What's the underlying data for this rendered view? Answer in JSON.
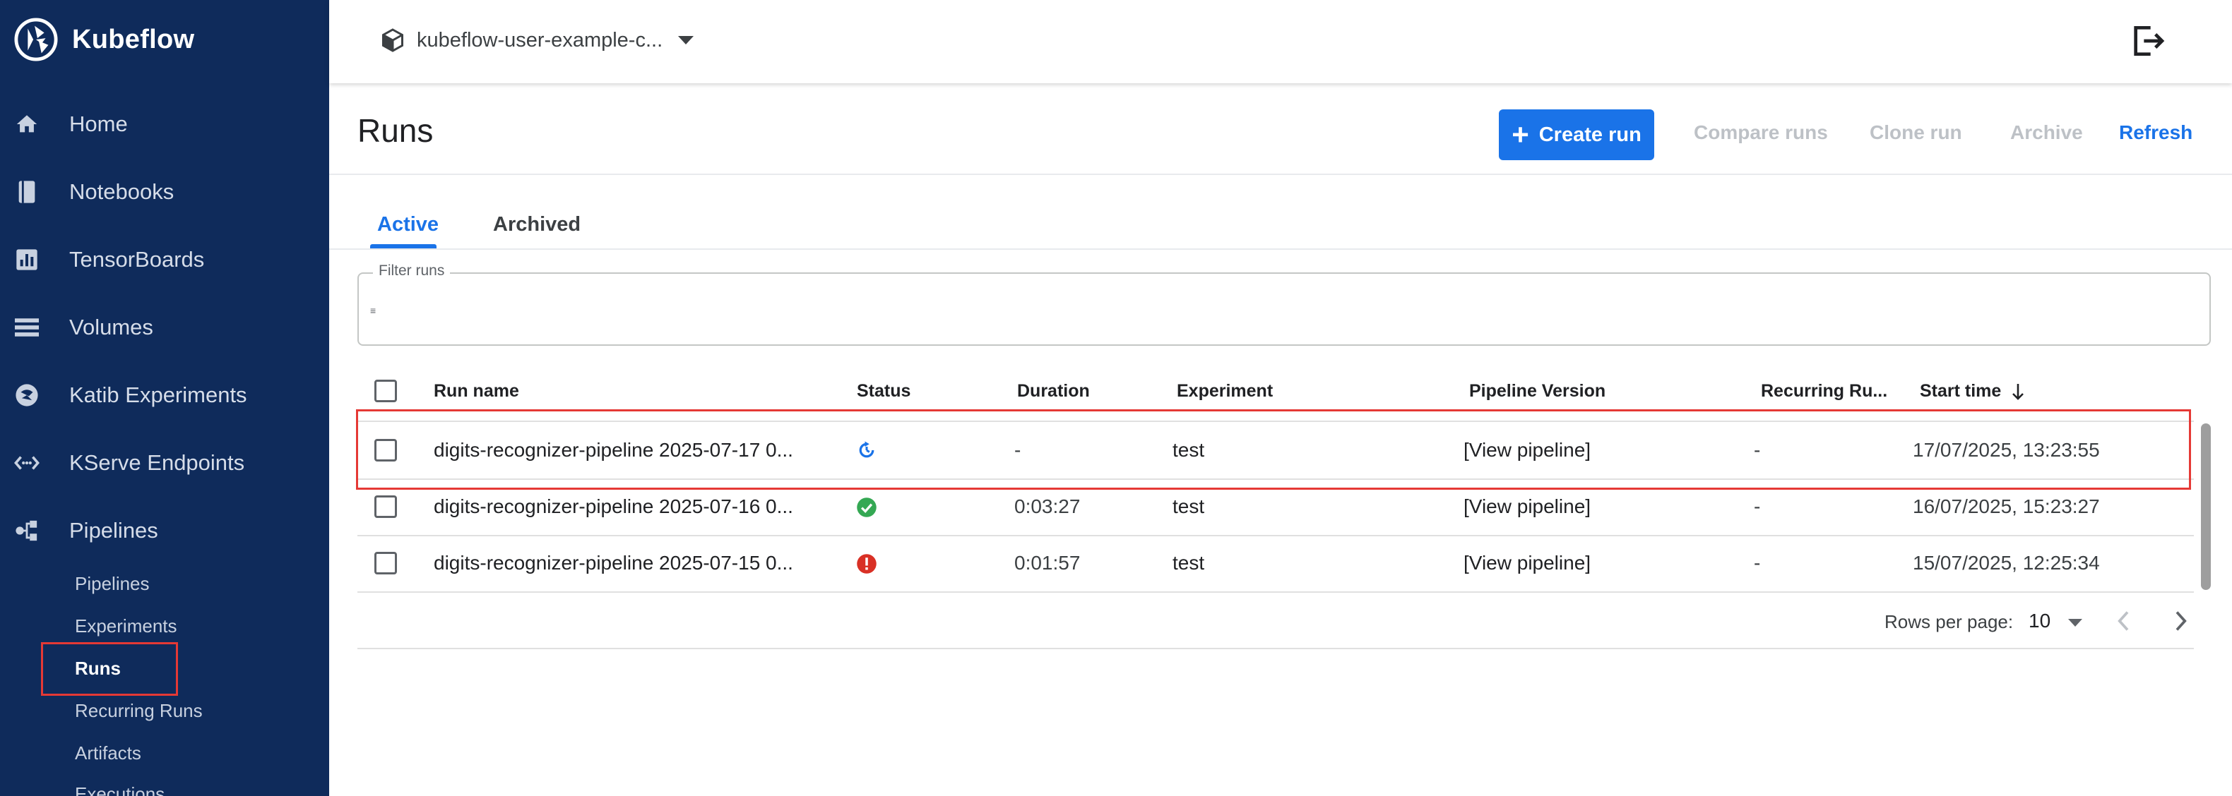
{
  "app": {
    "name": "Kubeflow"
  },
  "sidebar": {
    "items": [
      {
        "label": "Home",
        "icon": "home-icon"
      },
      {
        "label": "Notebooks",
        "icon": "notebook-icon"
      },
      {
        "label": "TensorBoards",
        "icon": "chart-icon"
      },
      {
        "label": "Volumes",
        "icon": "storage-icon"
      },
      {
        "label": "Katib Experiments",
        "icon": "experiment-icon"
      },
      {
        "label": "KServe Endpoints",
        "icon": "endpoint-icon"
      },
      {
        "label": "Pipelines",
        "icon": "pipeline-icon"
      }
    ],
    "subitems": [
      "Pipelines",
      "Experiments",
      "Runs",
      "Recurring Runs",
      "Artifacts",
      "Executions"
    ],
    "active_subitem": "Runs"
  },
  "topbar": {
    "namespace": "kubeflow-user-example-c...",
    "logout_icon": "logout-icon"
  },
  "page": {
    "title": "Runs",
    "toolbar": {
      "create": "Create run",
      "compare": "Compare runs",
      "clone": "Clone run",
      "archive": "Archive",
      "refresh": "Refresh"
    },
    "tabs": [
      "Active",
      "Archived"
    ],
    "active_tab": "Active",
    "filter": {
      "label": "Filter runs",
      "value": ""
    }
  },
  "table": {
    "columns": [
      "Run name",
      "Status",
      "Duration",
      "Experiment",
      "Pipeline Version",
      "Recurring Ru...",
      "Start time"
    ],
    "sort_column": "Start time",
    "sort_direction": "descending",
    "rows": [
      {
        "name": "digits-recognizer-pipeline 2025-07-17 0...",
        "status": "running",
        "status_icon": "running-icon",
        "duration": "-",
        "experiment": "test",
        "pipeline": "[View pipeline]",
        "recurring": "-",
        "start": "17/07/2025, 13:23:55"
      },
      {
        "name": "digits-recognizer-pipeline 2025-07-16 0...",
        "status": "succeeded",
        "status_icon": "success-icon",
        "duration": "0:03:27",
        "experiment": "test",
        "pipeline": "[View pipeline]",
        "recurring": "-",
        "start": "16/07/2025, 15:23:27"
      },
      {
        "name": "digits-recognizer-pipeline 2025-07-15 0...",
        "status": "failed",
        "status_icon": "error-icon",
        "duration": "0:01:57",
        "experiment": "test",
        "pipeline": "[View pipeline]",
        "recurring": "-",
        "start": "15/07/2025, 12:25:34"
      }
    ]
  },
  "pagination": {
    "label": "Rows per page:",
    "rows_per_page": "10"
  },
  "colors": {
    "sidebar": "#0f2b5b",
    "accent": "#1a73e8",
    "success": "#34a853",
    "error": "#d93025",
    "highlight": "#e53935"
  }
}
